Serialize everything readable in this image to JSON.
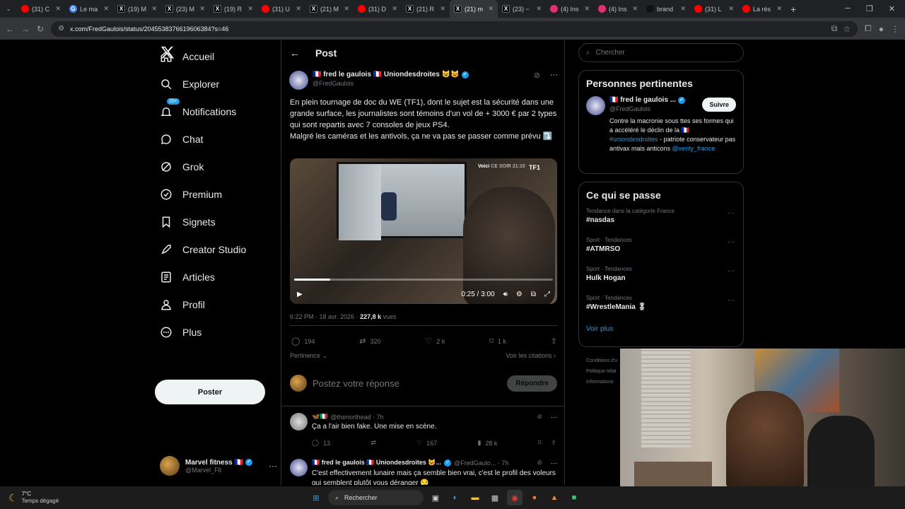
{
  "browser": {
    "tabs": [
      {
        "label": "(31) C",
        "icon": "youtube-icon",
        "color": "#ff0000"
      },
      {
        "label": "Le ma",
        "icon": "google-icon",
        "color": "#4285f4"
      },
      {
        "label": "(19) M",
        "icon": "x-icon",
        "color": "#000000"
      },
      {
        "label": "(23) M",
        "icon": "x-icon",
        "color": "#000000"
      },
      {
        "label": "(19) R",
        "icon": "x-icon",
        "color": "#000000"
      },
      {
        "label": "(31) U",
        "icon": "youtube-icon",
        "color": "#ff0000"
      },
      {
        "label": "(21) M",
        "icon": "x-icon",
        "color": "#000000"
      },
      {
        "label": "(31) D",
        "icon": "youtube-icon",
        "color": "#ff0000"
      },
      {
        "label": "(21) R",
        "icon": "x-icon",
        "color": "#000000"
      },
      {
        "label": "(21) m",
        "icon": "x-icon",
        "color": "#000000",
        "active": true
      },
      {
        "label": "(23) ~",
        "icon": "x-icon",
        "color": "#000000"
      },
      {
        "label": "(4) Ins",
        "icon": "instagram-icon",
        "color": "#e1306c"
      },
      {
        "label": "(4) Ins",
        "icon": "instagram-icon",
        "color": "#e1306c"
      },
      {
        "label": "brand",
        "icon": "tiktok-icon",
        "color": "#111111"
      },
      {
        "label": "(31) L",
        "icon": "youtube-icon",
        "color": "#ff0000"
      },
      {
        "label": "La rés",
        "icon": "youtube-icon",
        "color": "#ff0000"
      }
    ],
    "url": "x.com/FredGaulois/status/2045538376619606384?s=46"
  },
  "nav": {
    "items": [
      {
        "label": "Accueil",
        "icon": "home-icon"
      },
      {
        "label": "Explorer",
        "icon": "search-icon"
      },
      {
        "label": "Notifications",
        "icon": "bell-icon"
      },
      {
        "label": "Chat",
        "icon": "chat-icon"
      },
      {
        "label": "Grok",
        "icon": "grok-icon"
      },
      {
        "label": "Premium",
        "icon": "premium-icon"
      },
      {
        "label": "Signets",
        "icon": "bookmark-icon"
      },
      {
        "label": "Creator Studio",
        "icon": "rocket-icon"
      },
      {
        "label": "Articles",
        "icon": "articles-icon"
      },
      {
        "label": "Profil",
        "icon": "person-icon"
      },
      {
        "label": "Plus",
        "icon": "more-circle-icon"
      }
    ],
    "notif_badge": "20+",
    "post_button": "Poster",
    "account": {
      "name": "Marvel fitness 🇫🇷",
      "handle": "@Marvel_Flt"
    }
  },
  "header": {
    "title": "Post"
  },
  "tweet": {
    "author": "🇫🇷 fred le gaulois 🇫🇷 Uniondesdroites 😺😺",
    "handle": "@FredGaulois",
    "text": "En plein tournage de doc du WE (TF1), dont le sujet est la sécurité dans une grande surface, les journalistes sont témoins d'un vol de + 3000 € par 2 types qui sont repartis avec 7 consoles de jeux PS4.\nMalgré les caméras et les antivols, ça ne va pas se passer comme prévu ⤵️",
    "video": {
      "time": "0:25 / 3:00",
      "progress": 0.139,
      "channel_tag": "TF1"
    },
    "timestamp": "6:22 PM · 18 avr. 2026 · ",
    "views": "227,8 k",
    "views_label": " vues",
    "stats": {
      "replies": "194",
      "reposts": "320",
      "likes": "2 k",
      "bookmarks": "1 k"
    },
    "sort_label": "Pertinence",
    "quotes_label": "Voir les citations"
  },
  "reply_box": {
    "placeholder": "Postez votre réponse",
    "button": "Répondre"
  },
  "replies": [
    {
      "author": "🦋🇮🇹",
      "handle": "@thenorthead · 7h",
      "text": "Ça a l'air bien fake. Une mise en scène.",
      "stats": {
        "replies": "13",
        "likes": "167",
        "views": "28 k"
      }
    },
    {
      "author": "🇫🇷 fred le gaulois 🇫🇷 Uniondesdroites 😺...",
      "handle": "@FredGaulo... · 7h",
      "text": "C'est effectivement lunaire mais ça semble bien vrai, c'est le profil des voleurs qui semblent plutôt vous déranger 😏"
    }
  ],
  "right": {
    "search_placeholder": "Chercher",
    "relevant": {
      "title": "Personnes pertinentes",
      "name": "🇫🇷 fred le gaulois ...",
      "handle": "@FredGaulois",
      "follow": "Suivre",
      "bio_1": "Contre la macronie sous ttes ses formes qui a accéléré le déclin de la 🇫🇷 ",
      "bio_tag": "#uniondesdroites",
      "bio_2": " - patriote conservateur pas antivax mais anticons ",
      "bio_mention": "@verity_france"
    },
    "happening": {
      "title": "Ce qui se passe",
      "trends": [
        {
          "category": "Tendance dans la catégorie France",
          "name": "#nasdas"
        },
        {
          "category": "Sport · Tendances",
          "name": "#ATMRSO"
        },
        {
          "category": "Sport · Tendances",
          "name": "Hulk Hogan"
        },
        {
          "category": "Sport · Tendances",
          "name": "#WrestleMania 🎖"
        }
      ],
      "more": "Voir plus"
    },
    "footer": [
      "Conditions d'u",
      "Politique relat",
      "Informations"
    ]
  },
  "taskbar": {
    "weather_temp": "7°C",
    "weather_desc": "Temps dégagé",
    "search": "Rechercher"
  }
}
